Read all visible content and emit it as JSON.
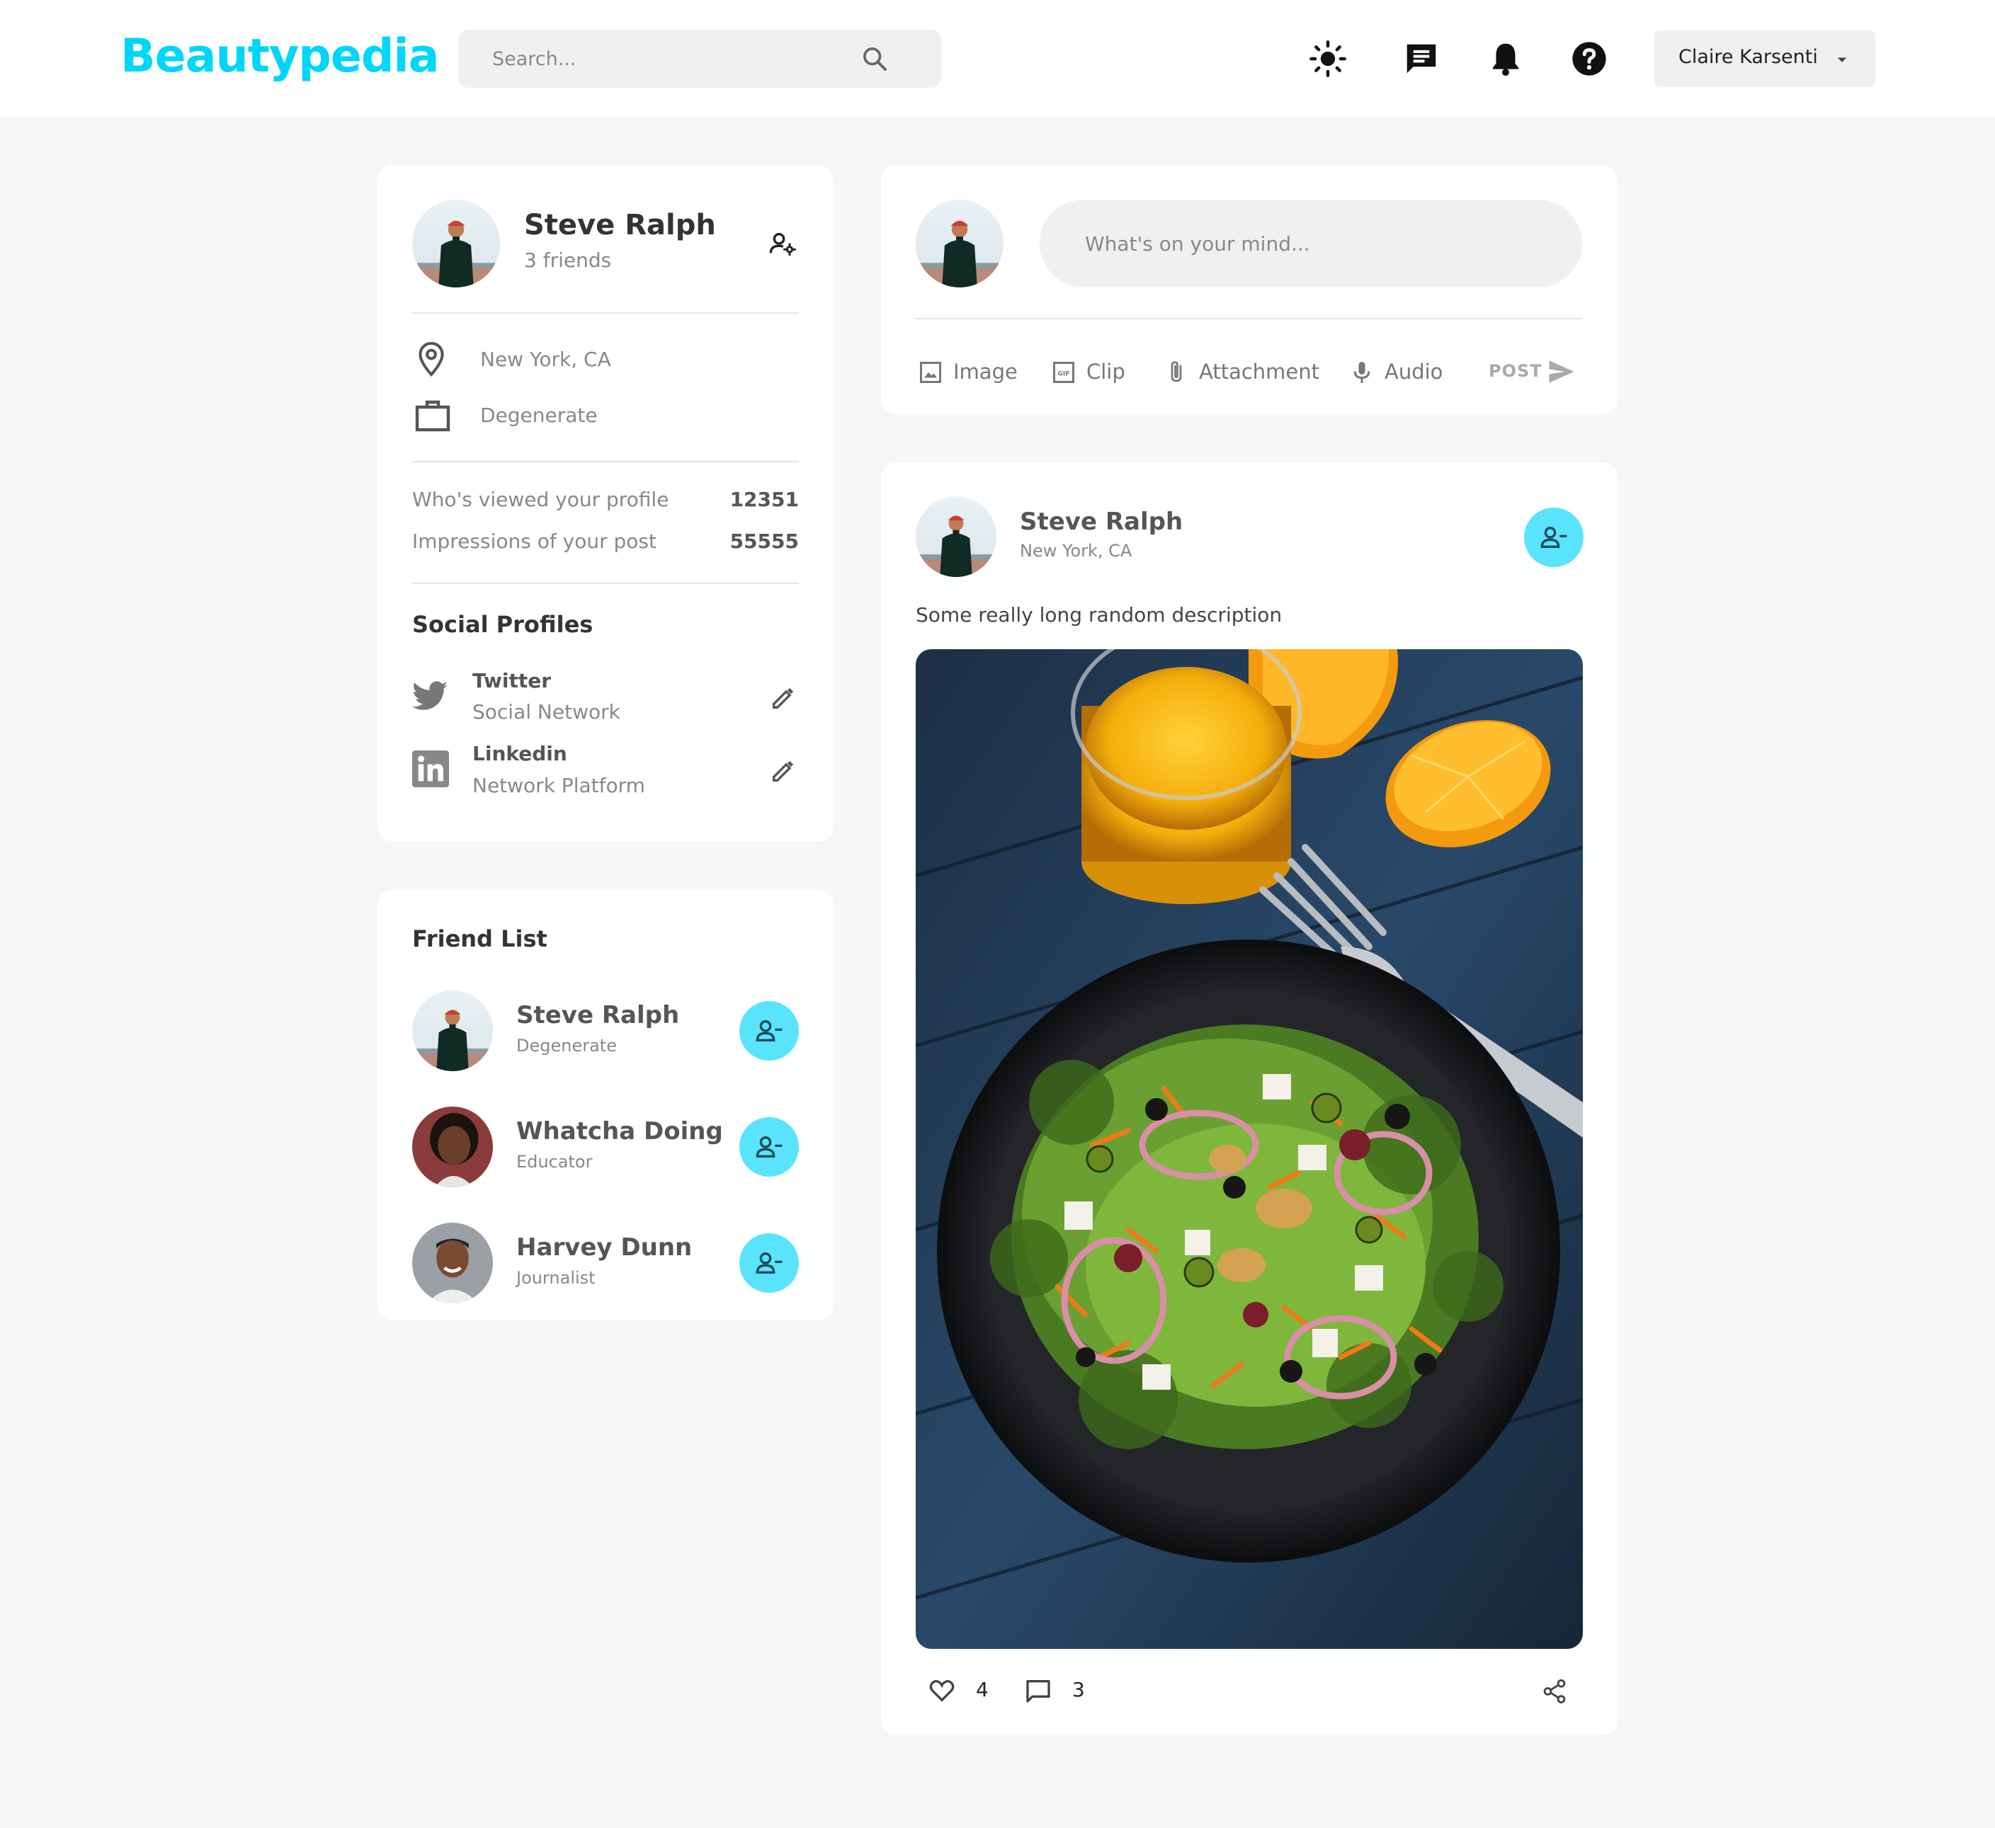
{
  "navbar": {
    "logo": "Beautypedia",
    "search_placeholder": "Search...",
    "icons": [
      "light-mode-icon",
      "message-icon",
      "notification-icon",
      "help-icon"
    ],
    "user_name": "Claire Karsenti"
  },
  "profile": {
    "name": "Steve Ralph",
    "friends": "3 friends",
    "location": "New York, CA",
    "occupation": "Degenerate",
    "stats": [
      {
        "label": "Who's viewed your profile",
        "value": "12351"
      },
      {
        "label": "Impressions of your post",
        "value": "55555"
      }
    ],
    "social_heading": "Social Profiles",
    "social": [
      {
        "name": "Twitter",
        "type": "Social Network"
      },
      {
        "name": "Linkedin",
        "type": "Network Platform"
      }
    ]
  },
  "friend_list": {
    "heading": "Friend List",
    "friends": [
      {
        "name": "Steve Ralph",
        "occupation": "Degenerate"
      },
      {
        "name": "Whatcha Doing",
        "occupation": "Educator"
      },
      {
        "name": "Harvey Dunn",
        "occupation": "Journalist"
      }
    ]
  },
  "composer": {
    "placeholder": "What's on your mind...",
    "tools": [
      {
        "label": "Image",
        "icon": "image-icon"
      },
      {
        "label": "Clip",
        "icon": "gif-icon"
      },
      {
        "label": "Attachment",
        "icon": "attachment-icon"
      },
      {
        "label": "Audio",
        "icon": "microphone-icon"
      }
    ],
    "post_label": "POST"
  },
  "post": {
    "author": "Steve Ralph",
    "location": "New York, CA",
    "description": "Some really long random description",
    "likes": "4",
    "comments": "3"
  },
  "colors": {
    "accent": "#00d5fa",
    "button": "#5ae3fc",
    "background": "#f6f6f6"
  }
}
